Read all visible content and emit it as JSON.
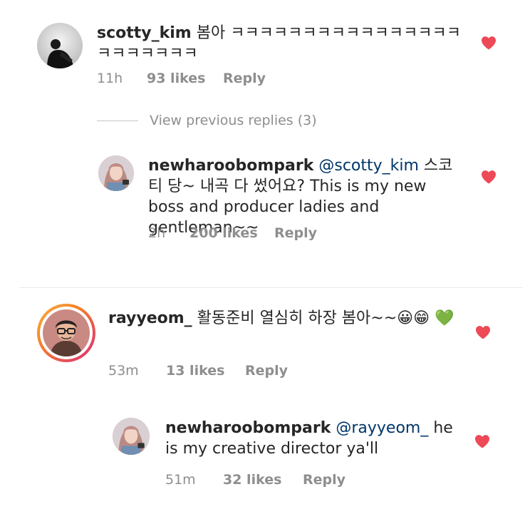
{
  "comments": [
    {
      "username": "scotty_kim",
      "text": " 봄아 ㅋㅋㅋㅋㅋㅋㅋㅋㅋㅋㅋㅋㅋㅋㅋㅋ ㅋㅋㅋㅋㅋㅋㅋ",
      "time": "11h",
      "likes": "93 likes",
      "reply": "Reply",
      "liked": true
    },
    {
      "view_previous": "View previous replies (3)"
    },
    {
      "username": "newharoobompark",
      "mention": "@scotty_kim",
      "text": " 스코티 당~ 내곡 다 썼어요? This is my new boss and producer ladies and gentleman~~",
      "time": "2h",
      "likes": "200 likes",
      "reply": "Reply",
      "liked": true
    },
    {
      "username": "rayyeom_",
      "text": " 활동준비 열심히 하장 봄아~~😀😁 💚",
      "time": "53m",
      "likes": "13 likes",
      "reply": "Reply",
      "liked": true,
      "has_story_ring": true
    },
    {
      "username": "newharoobompark",
      "mention": "@rayyeom_",
      "text": " he is my creative director ya'll",
      "time": "51m",
      "likes": "32 likes",
      "reply": "Reply",
      "liked": true
    }
  ],
  "colors": {
    "heart": "#ed4956",
    "meta": "#8e8e8e",
    "mention": "#003569",
    "story_ring_start": "#f58529",
    "story_ring_end": "#dd2a7b"
  },
  "icons": {
    "heart": "heart-filled-icon"
  }
}
